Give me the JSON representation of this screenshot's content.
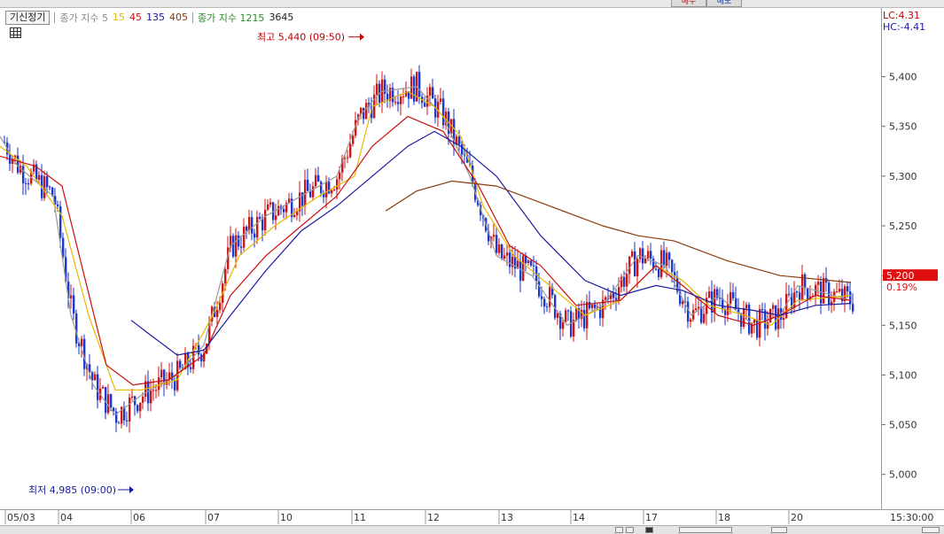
{
  "chart_data": {
    "type": "candlestick",
    "tab_label": "기신정기",
    "legend": [
      {
        "label": "종가 지수 5",
        "color": "#888888"
      },
      {
        "label": "15",
        "color": "#e8b800"
      },
      {
        "label": "45",
        "color": "#cc1010"
      },
      {
        "label": "135",
        "color": "#1a1aa0"
      },
      {
        "label": "405",
        "color": "#8b3a0a"
      },
      {
        "label": "종가 지수 1215",
        "color": "#2a8a2a"
      },
      {
        "label": "3645",
        "color": "#222222"
      }
    ],
    "ylim": [
      4965,
      5462
    ],
    "yticks": [
      5400,
      5350,
      5300,
      5250,
      5200,
      5150,
      5100,
      5050,
      5000
    ],
    "ytick_labels": [
      "5,400",
      "5,350",
      "5,300",
      "5,250",
      "5,200",
      "5,150",
      "5,100",
      "5,050",
      "5,000"
    ],
    "x_tick_labels": [
      "05/03",
      "04",
      "06",
      "07",
      "10",
      "11",
      "12",
      "13",
      "14",
      "17",
      "18",
      "20"
    ],
    "x_time_label": "15:30:00",
    "lc_label": "LC:4.31",
    "hc_label": "HC:-4.41",
    "current_price": 5200,
    "current_price_label": "5,200",
    "current_change_label": "0.19%",
    "high_annotation": "최고 5,440 (09:50)",
    "low_annotation": "최저 4,985 (09:00)",
    "daily_close": [
      5250,
      5180,
      5130,
      5170,
      5330,
      5380,
      5190,
      5170,
      5160,
      5180,
      5150,
      5190
    ],
    "ma5_path": [
      [
        0,
        5340
      ],
      [
        20,
        5310
      ],
      [
        60,
        5280
      ],
      [
        80,
        5160
      ],
      [
        105,
        5090
      ],
      [
        130,
        5060
      ],
      [
        160,
        5080
      ],
      [
        200,
        5100
      ],
      [
        230,
        5130
      ],
      [
        260,
        5230
      ],
      [
        300,
        5260
      ],
      [
        340,
        5280
      ],
      [
        380,
        5300
      ],
      [
        405,
        5360
      ],
      [
        430,
        5385
      ],
      [
        470,
        5390
      ],
      [
        500,
        5360
      ],
      [
        530,
        5300
      ],
      [
        560,
        5220
      ],
      [
        600,
        5200
      ],
      [
        640,
        5150
      ],
      [
        680,
        5170
      ],
      [
        720,
        5220
      ],
      [
        750,
        5210
      ],
      [
        780,
        5160
      ],
      [
        810,
        5180
      ],
      [
        850,
        5150
      ],
      [
        880,
        5160
      ],
      [
        900,
        5190
      ],
      [
        960,
        5175
      ]
    ],
    "ma15_path": [
      [
        0,
        5330
      ],
      [
        30,
        5310
      ],
      [
        70,
        5260
      ],
      [
        100,
        5160
      ],
      [
        130,
        5085
      ],
      [
        160,
        5085
      ],
      [
        200,
        5095
      ],
      [
        240,
        5160
      ],
      [
        270,
        5220
      ],
      [
        310,
        5250
      ],
      [
        360,
        5280
      ],
      [
        400,
        5300
      ],
      [
        420,
        5370
      ],
      [
        460,
        5385
      ],
      [
        490,
        5370
      ],
      [
        520,
        5340
      ],
      [
        545,
        5270
      ],
      [
        580,
        5220
      ],
      [
        620,
        5190
      ],
      [
        660,
        5160
      ],
      [
        700,
        5175
      ],
      [
        740,
        5210
      ],
      [
        770,
        5195
      ],
      [
        800,
        5170
      ],
      [
        840,
        5160
      ],
      [
        870,
        5150
      ],
      [
        900,
        5175
      ],
      [
        960,
        5180
      ]
    ],
    "ma45_path": [
      [
        0,
        5320
      ],
      [
        40,
        5310
      ],
      [
        70,
        5290
      ],
      [
        95,
        5200
      ],
      [
        120,
        5110
      ],
      [
        150,
        5090
      ],
      [
        190,
        5095
      ],
      [
        230,
        5120
      ],
      [
        260,
        5180
      ],
      [
        300,
        5220
      ],
      [
        340,
        5250
      ],
      [
        380,
        5280
      ],
      [
        420,
        5330
      ],
      [
        460,
        5360
      ],
      [
        500,
        5345
      ],
      [
        540,
        5290
      ],
      [
        575,
        5230
      ],
      [
        610,
        5210
      ],
      [
        650,
        5170
      ],
      [
        700,
        5175
      ],
      [
        740,
        5210
      ],
      [
        770,
        5190
      ],
      [
        810,
        5160
      ],
      [
        850,
        5150
      ],
      [
        880,
        5160
      ],
      [
        920,
        5180
      ],
      [
        960,
        5175
      ]
    ],
    "ma135_path": [
      [
        148,
        5155
      ],
      [
        170,
        5140
      ],
      [
        200,
        5120
      ],
      [
        230,
        5125
      ],
      [
        260,
        5160
      ],
      [
        300,
        5205
      ],
      [
        340,
        5245
      ],
      [
        380,
        5270
      ],
      [
        420,
        5300
      ],
      [
        460,
        5330
      ],
      [
        490,
        5345
      ],
      [
        520,
        5330
      ],
      [
        560,
        5300
      ],
      [
        610,
        5240
      ],
      [
        660,
        5195
      ],
      [
        700,
        5180
      ],
      [
        740,
        5190
      ],
      [
        770,
        5185
      ],
      [
        810,
        5170
      ],
      [
        850,
        5165
      ],
      [
        880,
        5160
      ],
      [
        920,
        5170
      ],
      [
        960,
        5172
      ]
    ],
    "ma405_path": [
      [
        435,
        5265
      ],
      [
        470,
        5285
      ],
      [
        510,
        5295
      ],
      [
        560,
        5290
      ],
      [
        620,
        5270
      ],
      [
        680,
        5250
      ],
      [
        720,
        5240
      ],
      [
        760,
        5235
      ],
      [
        820,
        5215
      ],
      [
        880,
        5200
      ],
      [
        960,
        5193
      ]
    ]
  },
  "header_buttons": [
    "매수",
    "매도"
  ]
}
